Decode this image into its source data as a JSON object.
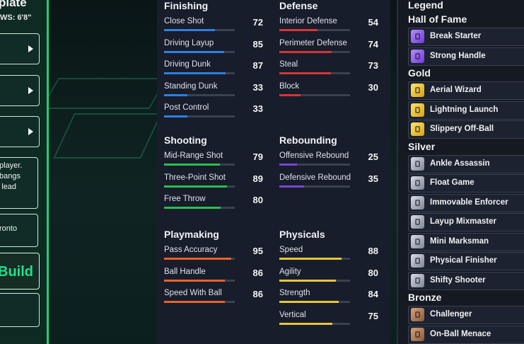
{
  "left_panel": {
    "title": "plate",
    "wingspan": "WS: 6'8\"",
    "note_lines": [
      "player.",
      "bangs",
      "lead"
    ],
    "location": "ronto",
    "build_label": "Build"
  },
  "attributes": {
    "groups": [
      {
        "title": "Finishing",
        "stats": [
          {
            "name": "Close Shot",
            "value": 72
          },
          {
            "name": "Driving Layup",
            "value": 85
          },
          {
            "name": "Driving Dunk",
            "value": 87
          },
          {
            "name": "Standing Dunk",
            "value": 33
          },
          {
            "name": "Post Control",
            "value": 33
          }
        ]
      },
      {
        "title": "Defense",
        "stats": [
          {
            "name": "Interior Defense",
            "value": 54
          },
          {
            "name": "Perimeter Defense",
            "value": 74
          },
          {
            "name": "Steal",
            "value": 73
          },
          {
            "name": "Block",
            "value": 30
          }
        ]
      },
      {
        "title": "Shooting",
        "stats": [
          {
            "name": "Mid-Range Shot",
            "value": 79
          },
          {
            "name": "Three-Point Shot",
            "value": 89
          },
          {
            "name": "Free Throw",
            "value": 80
          }
        ]
      },
      {
        "title": "Rebounding",
        "stats": [
          {
            "name": "Offensive Rebound",
            "value": 25
          },
          {
            "name": "Defensive Rebound",
            "value": 35
          }
        ]
      },
      {
        "title": "Playmaking",
        "stats": [
          {
            "name": "Pass Accuracy",
            "value": 95
          },
          {
            "name": "Ball Handle",
            "value": 86
          },
          {
            "name": "Speed With Ball",
            "value": 86
          }
        ]
      },
      {
        "title": "Physicals",
        "stats": [
          {
            "name": "Speed",
            "value": 88
          },
          {
            "name": "Agility",
            "value": 80
          },
          {
            "name": "Strength",
            "value": 84
          },
          {
            "name": "Vertical",
            "value": 75
          }
        ]
      }
    ],
    "colors": {
      "Finishing": "#2f7fe0",
      "Defense": "#d8333a",
      "Shooting": "#2dbd4e",
      "Rebounding": "#7a46d8",
      "Playmaking": "#e8622a",
      "Physicals": "#e8c53a"
    }
  },
  "legend": {
    "title": "Legend",
    "tiers": [
      {
        "name": "Hall of Fame",
        "icon": "hof",
        "badges": [
          "Break Starter",
          "Strong Handle"
        ]
      },
      {
        "name": "Gold",
        "icon": "gold",
        "badges": [
          "Aerial Wizard",
          "Lightning Launch",
          "Slippery Off-Ball"
        ]
      },
      {
        "name": "Silver",
        "icon": "silver",
        "badges": [
          "Ankle Assassin",
          "Float Game",
          "Immovable Enforcer",
          "Layup Mixmaster",
          "Mini Marksman",
          "Physical Finisher",
          "Shifty Shooter"
        ]
      },
      {
        "name": "Bronze",
        "icon": "bronze",
        "badges": [
          "Challenger",
          "On-Ball Menace"
        ]
      }
    ]
  }
}
